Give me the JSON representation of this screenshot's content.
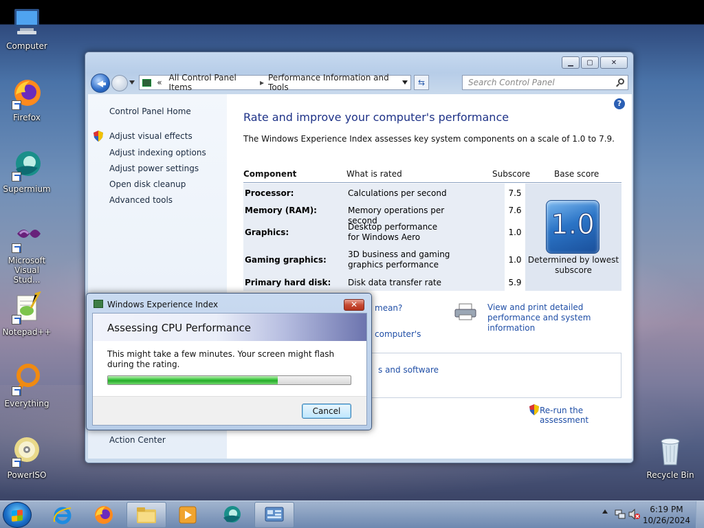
{
  "desktop": {
    "icons": [
      {
        "label": "Computer"
      },
      {
        "label": "Firefox"
      },
      {
        "label": "Supermium"
      },
      {
        "label": "Microsoft Visual Stud..."
      },
      {
        "label": "Notepad++"
      },
      {
        "label": "Everything"
      },
      {
        "label": "PowerISO"
      },
      {
        "label": "Recycle Bin"
      }
    ]
  },
  "window": {
    "address": {
      "prefix": "«",
      "crumb1": "All Control Panel Items",
      "crumb2": "Performance Information and Tools"
    },
    "search_placeholder": "Search Control Panel",
    "sidebar": {
      "home": "Control Panel Home",
      "links": [
        "Adjust visual effects",
        "Adjust indexing options",
        "Adjust power settings",
        "Open disk cleanup",
        "Advanced tools"
      ],
      "see_also_item": "Action Center"
    },
    "main": {
      "title": "Rate and improve your computer's performance",
      "description": "The Windows Experience Index assesses key system components on a scale of 1.0 to 7.9.",
      "table": {
        "headers": [
          "Component",
          "What is rated",
          "Subscore",
          "Base score"
        ],
        "rows": [
          {
            "component": "Processor:",
            "what": "Calculations per second",
            "subscore": "7.5"
          },
          {
            "component": "Memory (RAM):",
            "what": "Memory operations per second",
            "subscore": "7.6"
          },
          {
            "component": "Graphics:",
            "what": "Desktop performance for Windows Aero",
            "subscore": "1.0"
          },
          {
            "component": "Gaming graphics:",
            "what": "3D business and gaming graphics performance",
            "subscore": "1.0"
          },
          {
            "component": "Primary hard disk:",
            "what": "Disk data transfer rate",
            "subscore": "5.9"
          }
        ],
        "base_score": "1.0",
        "base_note": "Determined by lowest subscore"
      },
      "link_mean": "mean?",
      "link_computers": "computer's",
      "link_software": "s and software",
      "link_print": "View and print detailed performance and system information",
      "link_rerun": "Re-run the assessment",
      "help_label": "?"
    }
  },
  "dialog": {
    "title": "Windows Experience Index",
    "close_label": "✕",
    "heading": "Assessing CPU Performance",
    "message": "This might take a few minutes. Your screen might flash during the rating.",
    "progress_percent": 70,
    "cancel_label": "Cancel"
  },
  "taskbar": {
    "time": "6:19 PM",
    "date": "10/26/2024"
  },
  "colors": {
    "link": "#1f4ea6",
    "title_blue": "#1e3287",
    "progress_green": "#37c43a"
  }
}
